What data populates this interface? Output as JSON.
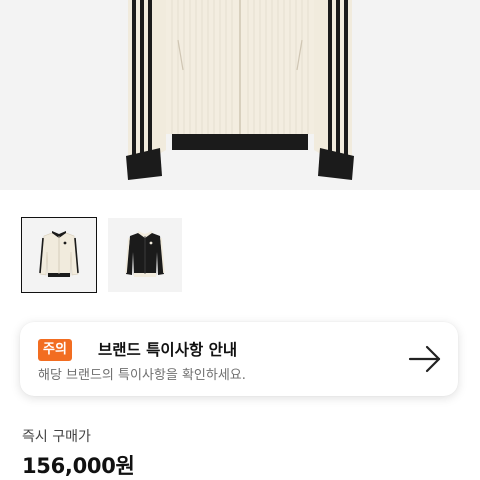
{
  "product": {
    "image_alt_icon": "jacket-image",
    "colors": {
      "cream": "#f3ede0",
      "black": "#1b1b1b",
      "background": "#f3f3f3"
    }
  },
  "thumbnails": [
    {
      "icon": "jacket-cream-thumbnail",
      "selected": true
    },
    {
      "icon": "jacket-black-thumbnail",
      "selected": false
    }
  ],
  "notice": {
    "badge": "주의",
    "title": "브랜드 특이사항 안내",
    "description": "해당 브랜드의 특이사항을 확인하세요.",
    "accent": "#f26d21"
  },
  "pricing": {
    "label": "즉시 구매가",
    "price": "156,000원"
  }
}
